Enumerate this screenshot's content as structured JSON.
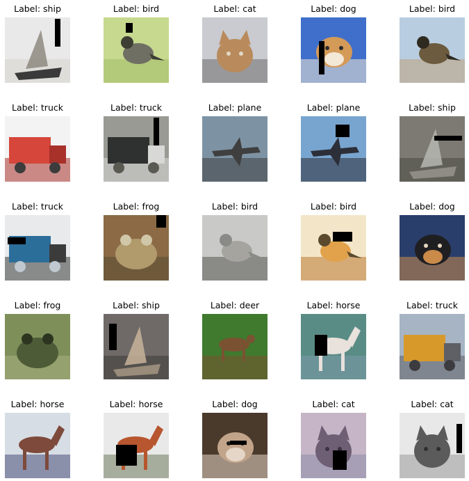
{
  "grid": {
    "cells": [
      {
        "label": "Label: ship",
        "subject": "ship",
        "palette": [
          "#e9e9e9",
          "#8e8a80",
          "#d7d3cc",
          "#3a3a3a"
        ],
        "mask": "vbar-tr"
      },
      {
        "label": "Label: bird",
        "subject": "bird",
        "palette": [
          "#c6d98f",
          "#6f6f63",
          "#a4bd6a",
          "#3d3d34"
        ],
        "mask": "square-tl"
      },
      {
        "label": "Label: cat",
        "subject": "cat",
        "palette": [
          "#c9cbd0",
          "#b98a5b",
          "#6f6f70",
          "#e2d8c8"
        ],
        "mask": "none"
      },
      {
        "label": "Label: dog",
        "subject": "dog",
        "palette": [
          "#3f6fcb",
          "#d49a58",
          "#f3e7d6",
          "#2b2b2b"
        ],
        "mask": "vbar-bl"
      },
      {
        "label": "Label: bird",
        "subject": "bird",
        "palette": [
          "#b8cde0",
          "#6c5b3e",
          "#c0a27d",
          "#2f2a20"
        ],
        "mask": "none"
      },
      {
        "label": "Label: truck",
        "subject": "truck",
        "palette": [
          "#f3f3f3",
          "#d6463b",
          "#a8312a",
          "#3c3c3c"
        ],
        "mask": "none"
      },
      {
        "label": "Label: truck",
        "subject": "truck",
        "palette": [
          "#9a9a94",
          "#2f3030",
          "#d8d8d6",
          "#5a5a52"
        ],
        "mask": "vbar-tr"
      },
      {
        "label": "Label: plane",
        "subject": "plane",
        "palette": [
          "#7d93a4",
          "#6b86b8",
          "#3f3f3f",
          "#e8b52b"
        ],
        "mask": "none"
      },
      {
        "label": "Label: plane",
        "subject": "plane",
        "palette": [
          "#78a5cf",
          "#c9d9ea",
          "#2d2f38",
          "#5c86b4"
        ],
        "mask": "square-tc"
      },
      {
        "label": "Label: ship",
        "subject": "ship",
        "palette": [
          "#7c7a72",
          "#b7b7b1",
          "#4a4a44",
          "#8e8c84"
        ],
        "mask": "hbar-tr"
      },
      {
        "label": "Label: truck",
        "subject": "truck",
        "palette": [
          "#e8eaec",
          "#2c6e9a",
          "#3b3b3b",
          "#bfc9cf"
        ],
        "mask": "hbar-ml"
      },
      {
        "label": "Label: frog",
        "subject": "frog",
        "palette": [
          "#8b6a45",
          "#b19a6b",
          "#5a4a33",
          "#d0c7a8"
        ],
        "mask": "square-tr"
      },
      {
        "label": "Label: bird",
        "subject": "bird",
        "palette": [
          "#c9c9c7",
          "#a5a49f",
          "#555552",
          "#8a8a86"
        ],
        "mask": "none"
      },
      {
        "label": "Label: bird",
        "subject": "bird",
        "palette": [
          "#f3e6c8",
          "#e2a24b",
          "#b97a35",
          "#5b4a2e"
        ],
        "mask": "hbar-mc"
      },
      {
        "label": "Label: dog",
        "subject": "dog",
        "palette": [
          "#2a3e6b",
          "#1f1f22",
          "#c98a4a",
          "#e7d7c1"
        ],
        "mask": "none"
      },
      {
        "label": "Label: frog",
        "subject": "frog",
        "palette": [
          "#7f8f5a",
          "#4d5c36",
          "#a7b07f",
          "#2d3520"
        ],
        "mask": "none"
      },
      {
        "label": "Label: ship",
        "subject": "ship",
        "palette": [
          "#6f6a67",
          "#c8b39a",
          "#3c3a38",
          "#9a8c7a"
        ],
        "mask": "vbar-tl"
      },
      {
        "label": "Label: deer",
        "subject": "deer",
        "palette": [
          "#3f7a2e",
          "#6aa13f",
          "#7a5232",
          "#2c5020"
        ],
        "mask": "none"
      },
      {
        "label": "Label: horse",
        "subject": "horse",
        "palette": [
          "#5a8c86",
          "#e8e1dc",
          "#7b9aa7",
          "#3d4a4a"
        ],
        "mask": "vbar-ml"
      },
      {
        "label": "Label: truck",
        "subject": "truck",
        "palette": [
          "#a6b4c4",
          "#d79a2a",
          "#5e6065",
          "#3c3c40"
        ],
        "mask": "none"
      },
      {
        "label": "Label: horse",
        "subject": "horse",
        "palette": [
          "#d7dde4",
          "#7d4a3b",
          "#4a4f7a",
          "#a9b77a"
        ],
        "mask": "none"
      },
      {
        "label": "Label: horse",
        "subject": "horse",
        "palette": [
          "#e9e9e9",
          "#b7562f",
          "#6f7b5f",
          "#2e2e2e"
        ],
        "mask": "square-bl"
      },
      {
        "label": "Label: dog",
        "subject": "dog",
        "palette": [
          "#4a3a2c",
          "#c2a48a",
          "#e5d6c7",
          "#1e1a16"
        ],
        "mask": "hbar-mr"
      },
      {
        "label": "Label: cat",
        "subject": "cat",
        "palette": [
          "#c6b5c7",
          "#6e5f74",
          "#8c8ca8",
          "#3a3242"
        ],
        "mask": "vbar-bc"
      },
      {
        "label": "Label: cat",
        "subject": "cat",
        "palette": [
          "#e8e8e8",
          "#5b5b5b",
          "#9b9b9b",
          "#2f2f2f"
        ],
        "mask": "vbar-r"
      }
    ]
  }
}
